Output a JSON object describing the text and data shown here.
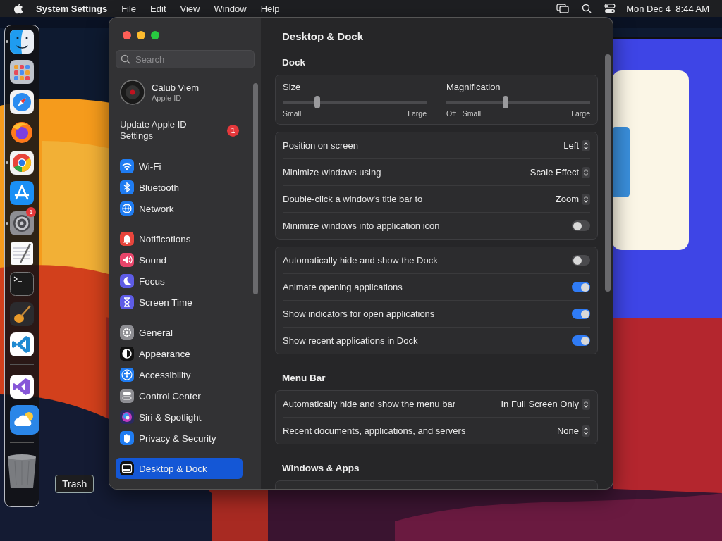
{
  "menu_bar": {
    "app_name": "System Settings",
    "menus": [
      "File",
      "Edit",
      "View",
      "Window",
      "Help"
    ],
    "clock": "Mon Dec 4  8:44 AM"
  },
  "dock": {
    "groups": [
      [
        {
          "kind": "finder",
          "running": true
        },
        {
          "kind": "launchpad",
          "running": false
        },
        {
          "kind": "safari",
          "running": false
        },
        {
          "kind": "firefox",
          "running": false
        },
        {
          "kind": "chrome",
          "running": true
        },
        {
          "kind": "appstore",
          "running": false
        },
        {
          "kind": "settings",
          "running": true,
          "badge": "1"
        },
        {
          "kind": "textedit",
          "running": false
        },
        {
          "kind": "terminal",
          "running": false
        },
        {
          "kind": "garageband",
          "running": false
        },
        {
          "kind": "vscode",
          "running": false
        }
      ],
      [
        {
          "kind": "visualstudio",
          "running": false
        },
        {
          "kind": "weather",
          "running": false
        }
      ],
      [
        {
          "kind": "trash",
          "running": false
        }
      ]
    ],
    "tooltip": "Trash"
  },
  "sidebar": {
    "search": {
      "placeholder": "Search"
    },
    "account": {
      "name": "Calub Viem",
      "subtitle": "Apple ID"
    },
    "update": {
      "label": "Update Apple ID Settings",
      "badge": "1"
    },
    "groups": [
      [
        {
          "label": "Wi-Fi",
          "kind": "wifi",
          "selected": false
        },
        {
          "label": "Bluetooth",
          "kind": "bluetooth",
          "selected": false
        },
        {
          "label": "Network",
          "kind": "network",
          "selected": false
        }
      ],
      [
        {
          "label": "Notifications",
          "kind": "notifications",
          "selected": false
        },
        {
          "label": "Sound",
          "kind": "sound",
          "selected": false
        },
        {
          "label": "Focus",
          "kind": "focus",
          "selected": false
        },
        {
          "label": "Screen Time",
          "kind": "screentime",
          "selected": false
        }
      ],
      [
        {
          "label": "General",
          "kind": "general",
          "selected": false
        },
        {
          "label": "Appearance",
          "kind": "appearance",
          "selected": false
        },
        {
          "label": "Accessibility",
          "kind": "accessibility",
          "selected": false
        },
        {
          "label": "Control Center",
          "kind": "controlcenter",
          "selected": false
        },
        {
          "label": "Siri & Spotlight",
          "kind": "siri",
          "selected": false
        },
        {
          "label": "Privacy & Security",
          "kind": "privacy",
          "selected": false
        }
      ],
      [
        {
          "label": "Desktop & Dock",
          "kind": "desktop",
          "selected": true
        }
      ]
    ]
  },
  "pane": {
    "title": "Desktop & Dock",
    "sections": [
      {
        "heading": "Dock",
        "cards": [
          {
            "kind": "sliders",
            "sliders": [
              {
                "label": "Size",
                "level": 0.24,
                "marks": [
                  "Small",
                  "Large"
                ]
              },
              {
                "label": "Magnification",
                "level": 0.41,
                "marks": [
                  "Off",
                  "Small",
                  "Large"
                ]
              }
            ]
          },
          {
            "kind": "rows",
            "rows": [
              {
                "kind": "popup",
                "label": "Position on screen",
                "value": "Left"
              },
              {
                "kind": "popup",
                "label": "Minimize windows using",
                "value": "Scale Effect"
              },
              {
                "kind": "popup",
                "label": "Double-click a window's title bar to",
                "value": "Zoom"
              },
              {
                "kind": "toggle",
                "label": "Minimize windows into application icon",
                "on": false
              }
            ]
          },
          {
            "kind": "rows",
            "rows": [
              {
                "kind": "toggle",
                "label": "Automatically hide and show the Dock",
                "on": false
              },
              {
                "kind": "toggle",
                "label": "Animate opening applications",
                "on": true
              },
              {
                "kind": "toggle",
                "label": "Show indicators for open applications",
                "on": true
              },
              {
                "kind": "toggle",
                "label": "Show recent applications in Dock",
                "on": true
              }
            ]
          }
        ]
      },
      {
        "heading": "Menu Bar",
        "cards": [
          {
            "kind": "rows",
            "rows": [
              {
                "kind": "popup",
                "label": "Automatically hide and show the menu bar",
                "value": "In Full Screen Only"
              },
              {
                "kind": "popup",
                "label": "Recent documents, applications, and servers",
                "value": "None"
              }
            ]
          }
        ]
      },
      {
        "heading": "Windows & Apps",
        "cards": [
          {
            "kind": "rows"
          }
        ]
      }
    ]
  }
}
